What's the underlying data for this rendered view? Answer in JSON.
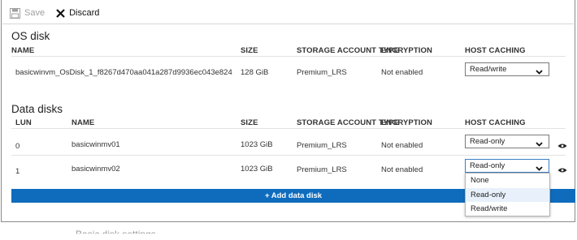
{
  "toolbar": {
    "save_label": "Save",
    "discard_label": "Discard"
  },
  "os_disk": {
    "title": "OS disk",
    "headers": {
      "name": "NAME",
      "size": "SIZE",
      "storage": "STORAGE ACCOUNT TYPE",
      "encryption": "ENCRYPTION",
      "caching": "HOST CACHING"
    },
    "row": {
      "name": "basicwinvm_OsDisk_1_f8267d470aa041a287d9936ec043e824",
      "size": "128 GiB",
      "storage": "Premium_LRS",
      "encryption": "Not enabled",
      "caching": "Read/write"
    }
  },
  "data_disks": {
    "title": "Data disks",
    "headers": {
      "lun": "LUN",
      "name": "NAME",
      "size": "SIZE",
      "storage": "STORAGE ACCOUNT TYPE",
      "encryption": "ENCRYPTION",
      "caching": "HOST CACHING"
    },
    "rows": [
      {
        "lun": "0",
        "name": "basicwinmv01",
        "size": "1023 GiB",
        "storage": "Premium_LRS",
        "encryption": "Not enabled",
        "caching": "Read-only"
      },
      {
        "lun": "1",
        "name": "basicwinmv02",
        "size": "1023 GiB",
        "storage": "Premium_LRS",
        "encryption": "Not enabled",
        "caching": "Read-only"
      }
    ],
    "add_label": "+ Add data disk"
  },
  "caching_dropdown": {
    "options": [
      "None",
      "Read-only",
      "Read/write"
    ],
    "selected": "Read-only"
  },
  "footer_ghost_text": "Basic disk settings",
  "colors": {
    "accent": "#0f6cbd",
    "selected_option_bg": "#e8f1fb",
    "focus_border": "#3a7fc4"
  }
}
